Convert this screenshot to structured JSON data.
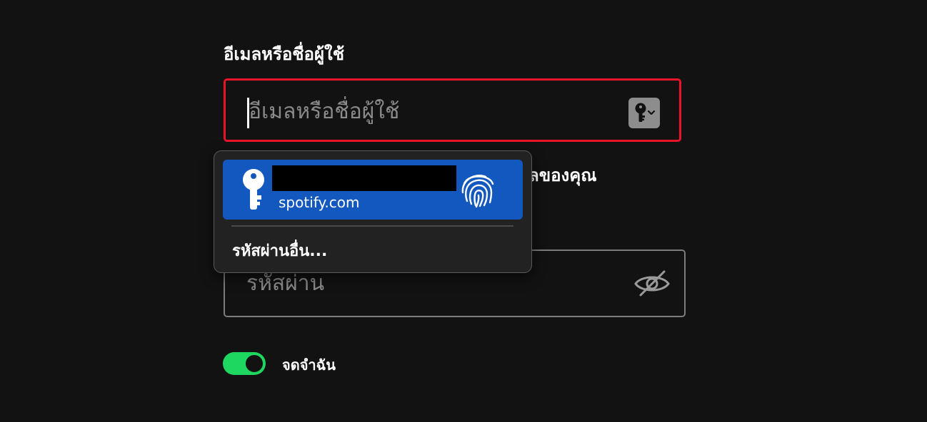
{
  "email": {
    "label": "อีเมลหรือชื่อผู้ใช้",
    "placeholder": "อีเมลหรือชื่อผู้ใช้",
    "key_icon": "key-dropdown-icon"
  },
  "partial_text": "ลของคุณ",
  "password": {
    "placeholder": "รหัสผ่าน",
    "eye_icon": "eye-slash-icon"
  },
  "remember": {
    "label": "จดจำฉัน",
    "on": true
  },
  "autofill": {
    "suggestion_domain": "spotify.com",
    "other_passwords_label": "รหัสผ่านอื่น..."
  },
  "colors": {
    "error_border": "#e91429",
    "toggle_on": "#1ed760",
    "suggestion_bg": "#1358bf",
    "background": "#121212"
  }
}
